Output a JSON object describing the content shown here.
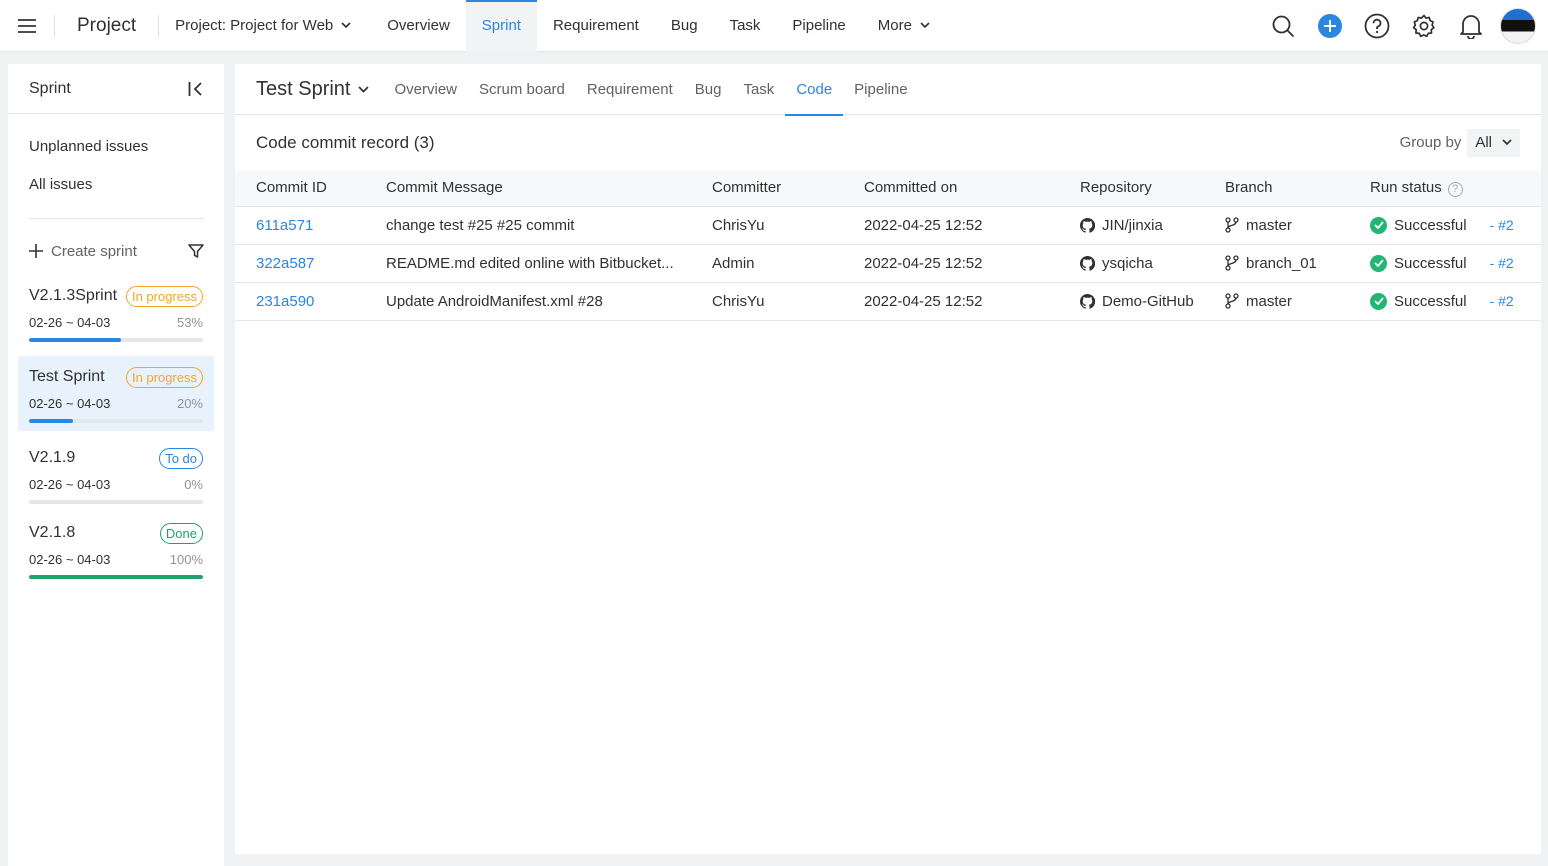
{
  "topbar": {
    "brand": "Project",
    "project_select": "Project: Project for Web",
    "nav": [
      "Overview",
      "Sprint",
      "Requirement",
      "Bug",
      "Task",
      "Pipeline",
      "More"
    ],
    "active_nav": "Sprint",
    "icons": [
      "search-icon",
      "add-icon",
      "help-icon",
      "gear-icon",
      "bell-icon"
    ],
    "accent": "#2b86e0"
  },
  "sidebar": {
    "title": "Sprint",
    "links": [
      "Unplanned issues",
      "All issues"
    ],
    "create_label": "Create sprint",
    "sprints": [
      {
        "name": "V2.1.3Sprint",
        "status": "In progress",
        "dates": "02-26 ~ 04-03",
        "pct": "53%",
        "progress": 0.53,
        "color": "#2b86e0"
      },
      {
        "name": "Test Sprint",
        "status": "In progress",
        "dates": "02-26 ~ 04-03",
        "pct": "20%",
        "progress": 0.25,
        "color": "#2b86e0"
      },
      {
        "name": "V2.1.9",
        "status": "To do",
        "dates": "02-26 ~ 04-03",
        "pct": "0%",
        "progress": 0,
        "color": "#2b86e0"
      },
      {
        "name": "V2.1.8",
        "status": "Done",
        "dates": "02-26 ~ 04-03",
        "pct": "100%",
        "progress": 1,
        "color": "#22a06b"
      }
    ]
  },
  "main": {
    "sprint_title": "Test Sprint",
    "tabs": [
      "Overview",
      "Scrum board",
      "Requirement",
      "Bug",
      "Task",
      "Code",
      "Pipeline"
    ],
    "active_tab": "Code",
    "record_title": "Code commit record (3)",
    "group_by_label": "Group by",
    "group_by_value": "All",
    "columns": [
      "Commit ID",
      "Commit Message",
      "Committer",
      "Committed on",
      "Repository",
      "Branch",
      "Run status"
    ],
    "rows": [
      {
        "id": "611a571",
        "message": "change test #25 #25 commit",
        "committer": "ChrisYu",
        "date": "2022-04-25 12:52",
        "repo": "JIN/jinxia",
        "branch": "master",
        "status": "Successful",
        "run": "- #2"
      },
      {
        "id": "322a587",
        "message": "README.md edited online with Bitbucket...",
        "committer": "Admin",
        "date": "2022-04-25 12:52",
        "repo": "ysqicha",
        "branch": "branch_01",
        "status": "Successful",
        "run": "- #2"
      },
      {
        "id": "231a590",
        "message": "Update AndroidManifest.xml #28",
        "committer": "ChrisYu",
        "date": "2022-04-25 12:52",
        "repo": "Demo-GitHub",
        "branch": "master",
        "status": "Successful",
        "run": "- #2"
      }
    ]
  }
}
